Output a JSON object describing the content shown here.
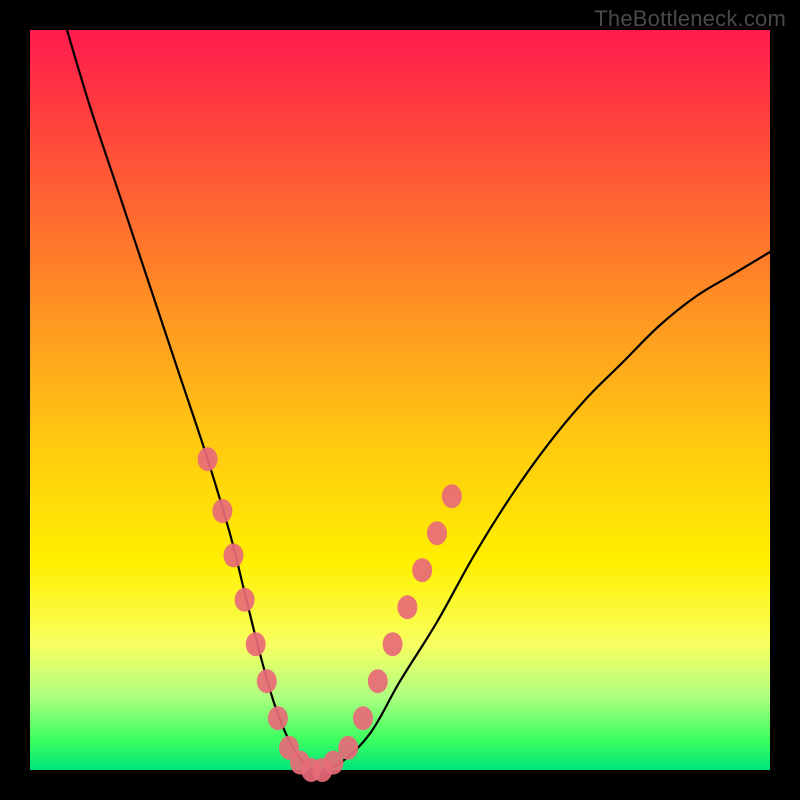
{
  "watermark": "TheBottleneck.com",
  "chart_data": {
    "type": "line",
    "title": "",
    "xlabel": "",
    "ylabel": "",
    "xlim": [
      0,
      100
    ],
    "ylim": [
      0,
      100
    ],
    "series": [
      {
        "name": "bottleneck-curve",
        "x": [
          5,
          8,
          12,
          16,
          20,
          24,
          27,
          29,
          31,
          33,
          35,
          37,
          39,
          42,
          46,
          50,
          55,
          60,
          65,
          70,
          75,
          80,
          85,
          90,
          95,
          100
        ],
        "y": [
          100,
          90,
          78,
          66,
          54,
          42,
          32,
          24,
          16,
          9,
          4,
          1,
          0,
          1,
          5,
          12,
          20,
          29,
          37,
          44,
          50,
          55,
          60,
          64,
          67,
          70
        ]
      }
    ],
    "markers": {
      "name": "highlight-dots",
      "color": "#e86a78",
      "points": [
        {
          "x": 24,
          "y": 42
        },
        {
          "x": 26,
          "y": 35
        },
        {
          "x": 27.5,
          "y": 29
        },
        {
          "x": 29,
          "y": 23
        },
        {
          "x": 30.5,
          "y": 17
        },
        {
          "x": 32,
          "y": 12
        },
        {
          "x": 33.5,
          "y": 7
        },
        {
          "x": 35,
          "y": 3
        },
        {
          "x": 36.5,
          "y": 1
        },
        {
          "x": 38,
          "y": 0
        },
        {
          "x": 39.5,
          "y": 0
        },
        {
          "x": 41,
          "y": 1
        },
        {
          "x": 43,
          "y": 3
        },
        {
          "x": 45,
          "y": 7
        },
        {
          "x": 47,
          "y": 12
        },
        {
          "x": 49,
          "y": 17
        },
        {
          "x": 51,
          "y": 22
        },
        {
          "x": 53,
          "y": 27
        },
        {
          "x": 55,
          "y": 32
        },
        {
          "x": 57,
          "y": 37
        }
      ]
    }
  }
}
